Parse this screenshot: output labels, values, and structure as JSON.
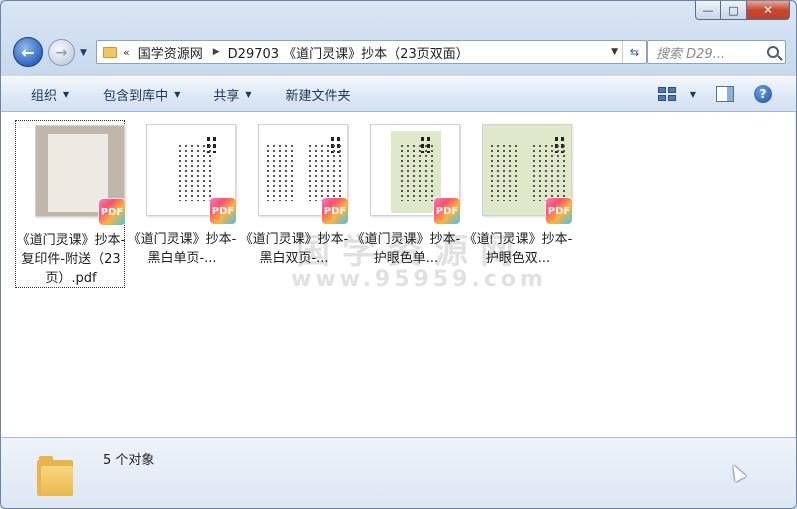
{
  "address_bar": {
    "overflow_chevron": "«",
    "segments": [
      "国学资源网",
      "D29703 《道门灵课》抄本（23页双面）"
    ]
  },
  "search": {
    "placeholder": "搜索 D29..."
  },
  "toolbar": {
    "organize": "组织",
    "include_in_library": "包含到库中",
    "share": "共享",
    "new_folder": "新建文件夹"
  },
  "files": [
    {
      "name": "《道门灵课》抄本-复印件-附送（23页）.pdf",
      "thumb_style": "photo",
      "badge": "PDF"
    },
    {
      "name": "《道门灵课》抄本-黑白单页-...",
      "thumb_style": "white",
      "badge": "PDF"
    },
    {
      "name": "《道门灵课》抄本-黑白双页-...",
      "thumb_style": "white-double",
      "badge": "PDF"
    },
    {
      "name": "《道门灵课》抄本-护眼色单...",
      "thumb_style": "green",
      "badge": "PDF"
    },
    {
      "name": "《道门灵课》抄本-护眼色双...",
      "thumb_style": "green-double",
      "badge": "PDF"
    }
  ],
  "watermark": {
    "line1": "国学资源网",
    "line2": "www.95959.com"
  },
  "status_bar": {
    "item_count": "5 个对象"
  },
  "colors": {
    "accent": "#2f67c0",
    "toolbar_text": "#1e395b",
    "eye_care_green": "#dfe9c9"
  }
}
